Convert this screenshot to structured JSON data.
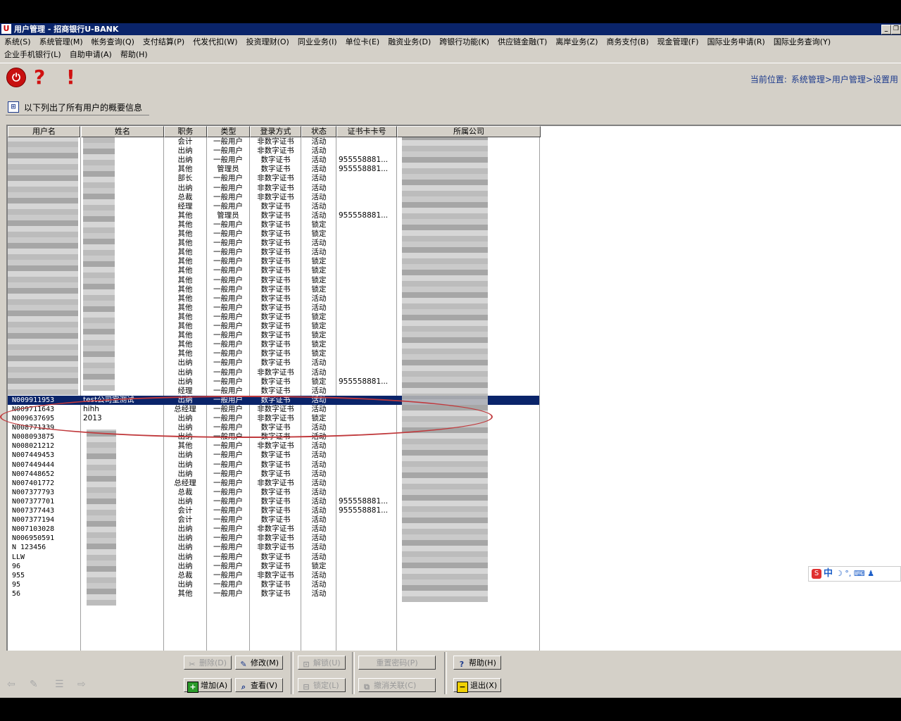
{
  "window": {
    "title": "用户管理 - 招商银行U-BANK",
    "app_icon_glyph": "U",
    "buttons": {
      "minimize": "_",
      "restore": "❐"
    }
  },
  "menu": {
    "row1": [
      "系统(S)",
      "系统管理(M)",
      "帐务查询(Q)",
      "支付结算(P)",
      "代发代扣(W)",
      "投资理财(O)",
      "同业业务(I)",
      "单位卡(E)",
      "融资业务(D)",
      "跨银行功能(K)",
      "供应链金融(T)",
      "离岸业务(Z)",
      "商务支付(B)",
      "现金管理(F)",
      "国际业务申请(R)",
      "国际业务查询(Y)"
    ],
    "row2": [
      "企业手机银行(L)",
      "自助申请(A)",
      "帮助(H)"
    ]
  },
  "toolbar": {
    "power_glyph": "⏻",
    "help_glyph": "?",
    "alert_glyph": "!"
  },
  "location": {
    "label": "当前位置:",
    "path": "系统管理>用户管理>设置用"
  },
  "info": {
    "icon_glyph": "⊞",
    "text": "以下列出了所有用户的概要信息"
  },
  "grid": {
    "columns": [
      "用户名",
      "姓名",
      "职务",
      "类型",
      "登录方式",
      "状态",
      "证书卡卡号",
      "所属公司"
    ],
    "rows": [
      {
        "user": "",
        "name": "",
        "pos": "会计",
        "type": "一般用户",
        "login": "非数字证书",
        "status": "活动",
        "cert": ""
      },
      {
        "user": "",
        "name": "",
        "pos": "出纳",
        "type": "一般用户",
        "login": "非数字证书",
        "status": "活动",
        "cert": ""
      },
      {
        "user": "",
        "name": "",
        "pos": "出纳",
        "type": "一般用户",
        "login": "数字证书",
        "status": "活动",
        "cert": "955558881..."
      },
      {
        "user": "",
        "name": "",
        "pos": "其他",
        "type": "管理员",
        "login": "数字证书",
        "status": "活动",
        "cert": "955558881..."
      },
      {
        "user": "",
        "name": "",
        "pos": "部长",
        "type": "一般用户",
        "login": "非数字证书",
        "status": "活动",
        "cert": ""
      },
      {
        "user": "",
        "name": "",
        "pos": "出纳",
        "type": "一般用户",
        "login": "非数字证书",
        "status": "活动",
        "cert": ""
      },
      {
        "user": "",
        "name": "",
        "pos": "总裁",
        "type": "一般用户",
        "login": "非数字证书",
        "status": "活动",
        "cert": ""
      },
      {
        "user": "",
        "name": "",
        "pos": "经理",
        "type": "一般用户",
        "login": "数字证书",
        "status": "活动",
        "cert": ""
      },
      {
        "user": "",
        "name": "",
        "pos": "其他",
        "type": "管理员",
        "login": "数字证书",
        "status": "活动",
        "cert": "955558881..."
      },
      {
        "user": "",
        "name": "",
        "pos": "其他",
        "type": "一般用户",
        "login": "数字证书",
        "status": "锁定",
        "cert": ""
      },
      {
        "user": "",
        "name": "",
        "pos": "其他",
        "type": "一般用户",
        "login": "数字证书",
        "status": "锁定",
        "cert": ""
      },
      {
        "user": "",
        "name": "",
        "pos": "其他",
        "type": "一般用户",
        "login": "数字证书",
        "status": "活动",
        "cert": ""
      },
      {
        "user": "",
        "name": "",
        "pos": "其他",
        "type": "一般用户",
        "login": "数字证书",
        "status": "活动",
        "cert": ""
      },
      {
        "user": "",
        "name": "",
        "pos": "其他",
        "type": "一般用户",
        "login": "数字证书",
        "status": "锁定",
        "cert": ""
      },
      {
        "user": "",
        "name": "",
        "pos": "其他",
        "type": "一般用户",
        "login": "数字证书",
        "status": "锁定",
        "cert": ""
      },
      {
        "user": "",
        "name": "",
        "pos": "其他",
        "type": "一般用户",
        "login": "数字证书",
        "status": "锁定",
        "cert": ""
      },
      {
        "user": "",
        "name": "",
        "pos": "其他",
        "type": "一般用户",
        "login": "数字证书",
        "status": "锁定",
        "cert": ""
      },
      {
        "user": "",
        "name": "",
        "pos": "其他",
        "type": "一般用户",
        "login": "数字证书",
        "status": "活动",
        "cert": ""
      },
      {
        "user": "",
        "name": "",
        "pos": "其他",
        "type": "一般用户",
        "login": "数字证书",
        "status": "活动",
        "cert": ""
      },
      {
        "user": "",
        "name": "",
        "pos": "其他",
        "type": "一般用户",
        "login": "数字证书",
        "status": "锁定",
        "cert": ""
      },
      {
        "user": "",
        "name": "",
        "pos": "其他",
        "type": "一般用户",
        "login": "数字证书",
        "status": "锁定",
        "cert": ""
      },
      {
        "user": "",
        "name": "",
        "pos": "其他",
        "type": "一般用户",
        "login": "数字证书",
        "status": "锁定",
        "cert": ""
      },
      {
        "user": "",
        "name": "",
        "pos": "其他",
        "type": "一般用户",
        "login": "数字证书",
        "status": "锁定",
        "cert": ""
      },
      {
        "user": "",
        "name": "",
        "pos": "其他",
        "type": "一般用户",
        "login": "数字证书",
        "status": "锁定",
        "cert": ""
      },
      {
        "user": "",
        "name": "",
        "pos": "出纳",
        "type": "一般用户",
        "login": "数字证书",
        "status": "活动",
        "cert": ""
      },
      {
        "user": "",
        "name": "",
        "pos": "出纳",
        "type": "一般用户",
        "login": "非数字证书",
        "status": "活动",
        "cert": ""
      },
      {
        "user": "",
        "name": "",
        "pos": "出纳",
        "type": "一般用户",
        "login": "数字证书",
        "status": "锁定",
        "cert": "955558881..."
      },
      {
        "user": "",
        "name": "",
        "pos": "经理",
        "type": "一般用户",
        "login": "数字证书",
        "status": "活动",
        "cert": ""
      },
      {
        "user": "N009911953",
        "name": "test公司室测试",
        "pos": "出纳",
        "type": "一般用户",
        "login": "数字证书",
        "status": "活动",
        "cert": "",
        "selected": true
      },
      {
        "user": "N009711643",
        "name": "hihh",
        "pos": "总经理",
        "type": "一般用户",
        "login": "非数字证书",
        "status": "活动",
        "cert": ""
      },
      {
        "user": "N009637695",
        "name": "2013",
        "pos": "出纳",
        "type": "一般用户",
        "login": "非数字证书",
        "status": "锁定",
        "cert": ""
      },
      {
        "user": "N008771339",
        "name": "",
        "pos": "出纳",
        "type": "一般用户",
        "login": "数字证书",
        "status": "活动",
        "cert": ""
      },
      {
        "user": "N008093875",
        "name": "",
        "pos": "出纳",
        "type": "一般用户",
        "login": "数字证书",
        "status": "活动",
        "cert": ""
      },
      {
        "user": "N008021212",
        "name": "",
        "pos": "其他",
        "type": "一般用户",
        "login": "非数字证书",
        "status": "活动",
        "cert": ""
      },
      {
        "user": "N007449453",
        "name": "",
        "pos": "出纳",
        "type": "一般用户",
        "login": "数字证书",
        "status": "活动",
        "cert": ""
      },
      {
        "user": "N007449444",
        "name": "",
        "pos": "出纳",
        "type": "一般用户",
        "login": "数字证书",
        "status": "活动",
        "cert": ""
      },
      {
        "user": "N007448652",
        "name": "",
        "pos": "出纳",
        "type": "一般用户",
        "login": "数字证书",
        "status": "活动",
        "cert": ""
      },
      {
        "user": "N007401772",
        "name": "",
        "pos": "总经理",
        "type": "一般用户",
        "login": "非数字证书",
        "status": "活动",
        "cert": ""
      },
      {
        "user": "N007377793",
        "name": "",
        "pos": "总裁",
        "type": "一般用户",
        "login": "数字证书",
        "status": "活动",
        "cert": ""
      },
      {
        "user": "N007377701",
        "name": "",
        "pos": "出纳",
        "type": "一般用户",
        "login": "数字证书",
        "status": "活动",
        "cert": "955558881..."
      },
      {
        "user": "N007377443",
        "name": "",
        "pos": "会计",
        "type": "一般用户",
        "login": "数字证书",
        "status": "活动",
        "cert": "955558881..."
      },
      {
        "user": "N007377194",
        "name": "",
        "pos": "会计",
        "type": "一般用户",
        "login": "数字证书",
        "status": "活动",
        "cert": ""
      },
      {
        "user": "N007103028",
        "name": "",
        "pos": "出纳",
        "type": "一般用户",
        "login": "非数字证书",
        "status": "活动",
        "cert": ""
      },
      {
        "user": "N006950591",
        "name": "",
        "pos": "出纳",
        "type": "一般用户",
        "login": "非数字证书",
        "status": "活动",
        "cert": ""
      },
      {
        "user": "N 123456",
        "name": "",
        "pos": "出纳",
        "type": "一般用户",
        "login": "非数字证书",
        "status": "活动",
        "cert": ""
      },
      {
        "user": "LLW",
        "name": "",
        "pos": "出纳",
        "type": "一般用户",
        "login": "数字证书",
        "status": "活动",
        "cert": ""
      },
      {
        "user": "96",
        "name": "",
        "pos": "出纳",
        "type": "一般用户",
        "login": "数字证书",
        "status": "锁定",
        "cert": ""
      },
      {
        "user": "955",
        "name": "",
        "pos": "总裁",
        "type": "一般用户",
        "login": "非数字证书",
        "status": "活动",
        "cert": ""
      },
      {
        "user": "95",
        "name": "",
        "pos": "出纳",
        "type": "一般用户",
        "login": "数字证书",
        "status": "活动",
        "cert": ""
      },
      {
        "user": "56",
        "name": "",
        "pos": "其他",
        "type": "一般用户",
        "login": "数字证书",
        "status": "活动",
        "cert": ""
      }
    ]
  },
  "ime": {
    "logo": "S",
    "mode": "中",
    "glyphs": "☽ °, ⌨ ♟"
  },
  "buttons": {
    "delete": "删除(D)",
    "modify": "修改(M)",
    "unlock": "解锁(U)",
    "reset_password": "重置密码(P)",
    "help": "帮助(H)",
    "add": "增加(A)",
    "view": "查看(V)",
    "lock": "锁定(L)",
    "cancel_link": "撤消关联(C)",
    "exit": "退出(X)"
  },
  "nav": {
    "back": "⇦",
    "edit": "✎",
    "list": "☰",
    "forward": "⇨"
  },
  "colors": {
    "selection": "#0a246a",
    "annotation": "#c0393c",
    "title_bar": "#0a246a"
  }
}
